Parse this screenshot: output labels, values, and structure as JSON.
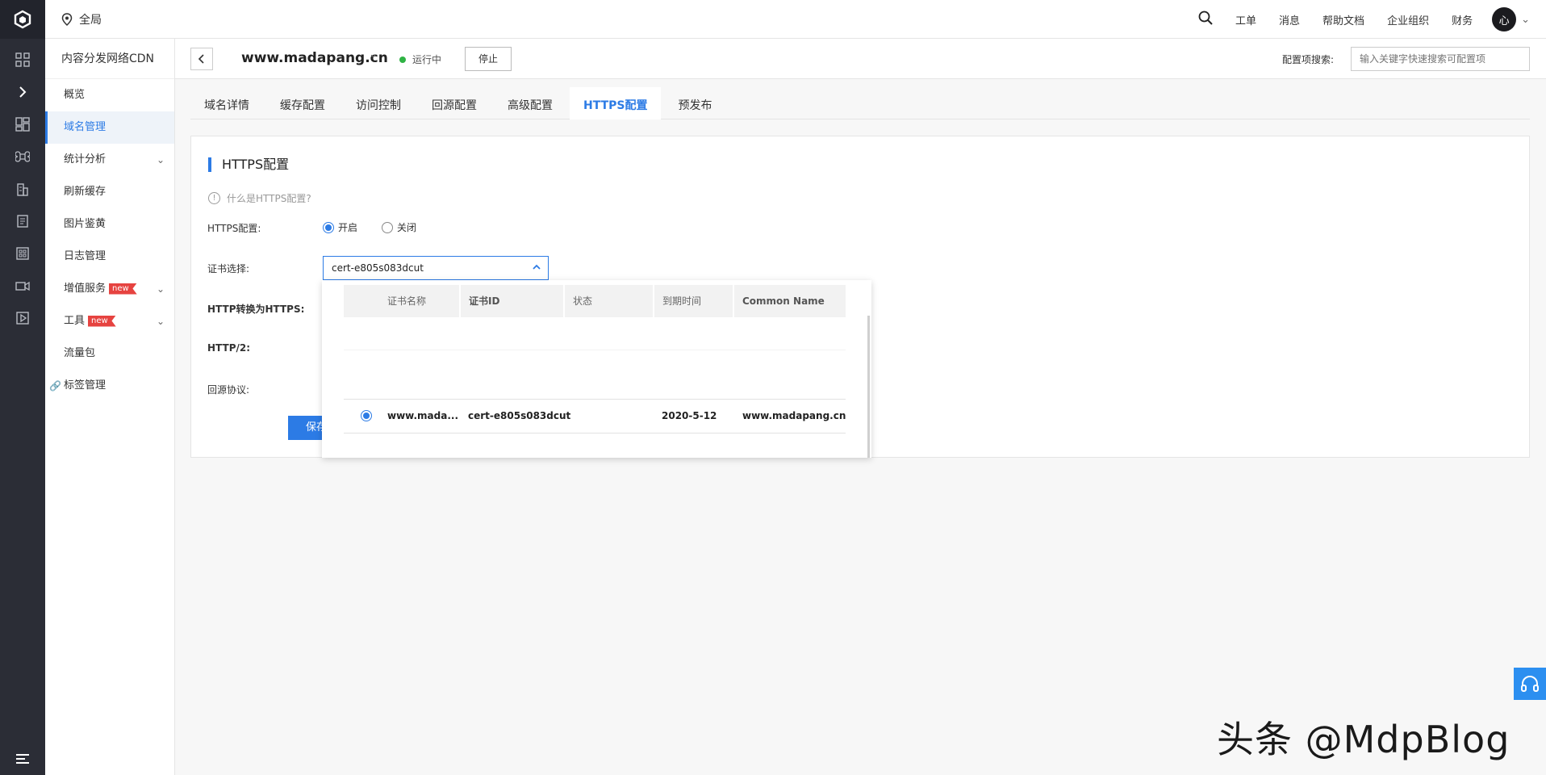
{
  "topbar": {
    "region": "全局",
    "nav": [
      "工单",
      "消息",
      "帮助文档",
      "企业组织",
      "财务"
    ],
    "avatar_text": "心"
  },
  "sidebar": {
    "title": "内容分发网络CDN",
    "items": [
      {
        "label": "概览"
      },
      {
        "label": "域名管理"
      },
      {
        "label": "统计分析"
      },
      {
        "label": "刷新缓存"
      },
      {
        "label": "图片鉴黄"
      },
      {
        "label": "日志管理"
      },
      {
        "label": "增值服务",
        "badge": "new"
      },
      {
        "label": "工具",
        "badge": "new"
      },
      {
        "label": "流量包"
      },
      {
        "label": "标签管理"
      }
    ]
  },
  "header": {
    "domain": "www.madapang.cn",
    "status": "运行中",
    "stop_label": "停止",
    "search_label": "配置项搜索:",
    "search_placeholder": "输入关键字快速搜索可配置项"
  },
  "tabs": [
    "域名详情",
    "缓存配置",
    "访问控制",
    "回源配置",
    "高级配置",
    "HTTPS配置",
    "预发布"
  ],
  "panel": {
    "title": "HTTPS配置",
    "help": "什么是HTTPS配置?",
    "https_label": "HTTPS配置:",
    "on_label": "开启",
    "off_label": "关闭",
    "cert_label": "证书选择:",
    "cert_value": "cert-e805s083dcut",
    "http_to_https_label": "HTTP转换为HTTPS:",
    "http2_label": "HTTP/2:",
    "origin_label": "回源协议:",
    "save_label": "保存"
  },
  "dropdown": {
    "columns": [
      "证书名称",
      "证书ID",
      "状态",
      "到期时间",
      "Common Name"
    ],
    "row": {
      "name": "www.mada...",
      "id": "cert-e805s083dcut",
      "status": "",
      "expire": "2020-5-12",
      "common_name": "www.madapang.cn"
    }
  },
  "watermark": "头条 @MdpBlog",
  "colors": {
    "accent": "#2c7be5",
    "rail": "#2b2d36",
    "status_green": "#2fb344",
    "badge_red": "#e64340"
  }
}
